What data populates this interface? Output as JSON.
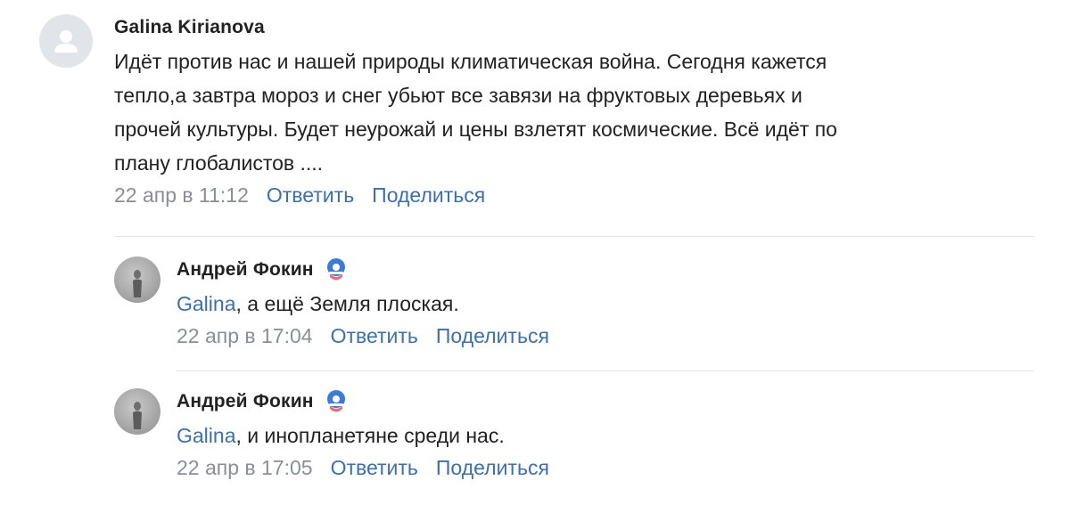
{
  "comments": [
    {
      "author": "Galina Kirianova",
      "text_lines": [
        "Идёт против нас и нашей природы климатическая война. Сегодня кажется",
        "тепло,а завтра мороз и снег убьют все завязи на фруктовых деревьях и",
        "прочей культуры. Будет неурожай и цены взлетят космические. Всё идёт по",
        "плану глобалистов ...."
      ],
      "timestamp": "22 апр в 11:12",
      "reply_label": "Ответить",
      "share_label": "Поделиться"
    }
  ],
  "replies": [
    {
      "author": "Андрей Фокин",
      "mention": "Galina",
      "text": ", а ещё Земля плоская.",
      "timestamp": "22 апр в 17:04",
      "reply_label": "Ответить",
      "share_label": "Поделиться",
      "badge_icon": "donut-badge-icon"
    },
    {
      "author": "Андрей Фокин",
      "mention": "Galina",
      "text": ", и инопланетяне среди нас.",
      "timestamp": "22 апр в 17:05",
      "reply_label": "Ответить",
      "share_label": "Поделиться",
      "badge_icon": "donut-badge-icon"
    }
  ],
  "colors": {
    "link": "#3f6fa8",
    "meta": "#8a8f96",
    "text": "#222222",
    "divider": "#e3e6ea"
  }
}
